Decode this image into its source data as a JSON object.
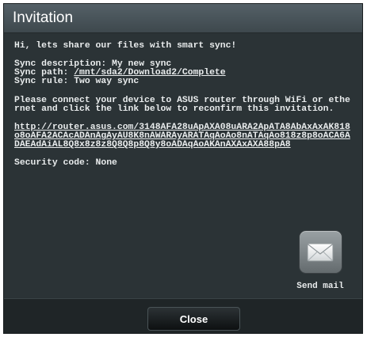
{
  "dialog": {
    "title": "Invitation",
    "greeting": "Hi, lets share our files with smart sync!",
    "sync": {
      "description_label": "Sync description: ",
      "description_value": "My new sync",
      "path_label": "Sync path: ",
      "path_value": "/mnt/sda2/Download2/Complete",
      "rule_label": "Sync rule: ",
      "rule_value": "Two way sync"
    },
    "instructions": "Please connect your device to ASUS router through WiFi or ethernet and click the link below to reconfirm this invitation.",
    "url": "http://router.asus.com/3148AFA28uApAXA08uARA2ApATA8AbAxAxAK818o8oAFA2ACAcADAnAgAyAU8K8nAWARAyARATAqAoAo8nATAqAo818z8p8oACA6ADAEAdAiAL8Q8x8z8z8Q8Q8p8Q8y8oADAqAoAKAnAXAxAXA88pA8",
    "security_code_label": "Security code: ",
    "security_code_value": "None",
    "send_mail_label": "Send mail",
    "close_label": "Close"
  },
  "icons": {
    "send_mail": "envelope-icon"
  },
  "colors": {
    "dialog_background": "#2b3336",
    "title_bar": "#4a555b",
    "text": "#e9eced",
    "footer": "#1f2527",
    "close_button": "#15191b"
  }
}
